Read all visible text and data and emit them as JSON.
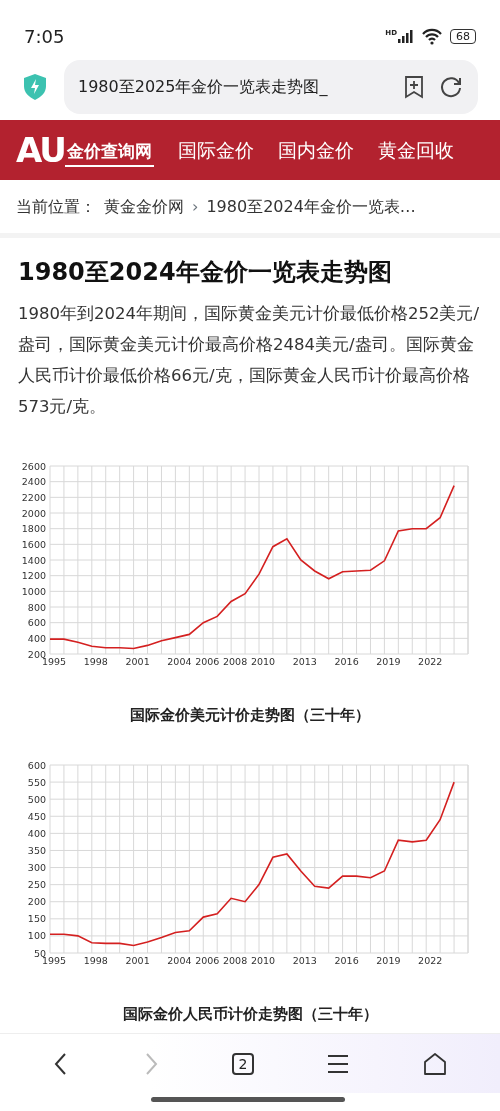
{
  "status_bar": {
    "time": "7:05",
    "network": "HD",
    "battery": "68"
  },
  "browser": {
    "address_text": "1980至2025年金价一览表走势图_"
  },
  "site_nav": {
    "logo_mark": "AU",
    "logo_text": "金价查询网",
    "items": [
      "国际金价",
      "国内金价",
      "黄金回收"
    ]
  },
  "breadcrumb": {
    "label": "当前位置：",
    "items": [
      {
        "text": "黄金金价网"
      },
      {
        "text": "1980至2024年金价一览表…",
        "separator": "›"
      }
    ]
  },
  "article": {
    "title": "1980至2024年金价一览表走势图",
    "paragraph": "1980年到2024年期间，国际黄金美元计价最低价格252美元/盎司，国际黄金美元计价最高价格2484美元/盎司。国际黄金人民币计价最低价格66元/克，国际黄金人民币计价最高价格573元/克。",
    "figures": [
      {
        "caption": "国际金价美元计价走势图（三十年）",
        "chart_data": {
          "type": "line",
          "x": [
            1995,
            1996,
            1997,
            1998,
            1999,
            2000,
            2001,
            2002,
            2003,
            2004,
            2005,
            2006,
            2007,
            2008,
            2009,
            2010,
            2011,
            2012,
            2013,
            2014,
            2015,
            2016,
            2017,
            2018,
            2019,
            2020,
            2021,
            2022,
            2023,
            2024
          ],
          "series": [
            {
              "color": "#d42020",
              "values": [
                390,
                390,
                350,
                300,
                280,
                280,
                270,
                310,
                370,
                410,
                450,
                600,
                680,
                870,
                970,
                1220,
                1570,
                1670,
                1400,
                1260,
                1160,
                1250,
                1260,
                1270,
                1390,
                1770,
                1800,
                1800,
                1940,
                2350
              ]
            }
          ],
          "xlim": [
            1995,
            2025
          ],
          "grid": true,
          "ylim": [
            200,
            2600
          ],
          "yticks": [
            200,
            400,
            600,
            800,
            1000,
            1200,
            1400,
            1600,
            1800,
            2000,
            2200,
            2400,
            2600
          ],
          "xticks": [
            1995,
            1998,
            2001,
            2004,
            2006,
            2008,
            2010,
            2013,
            2016,
            2019,
            2022
          ]
        }
      },
      {
        "caption": "国际金价人民币计价走势图（三十年）",
        "chart_data": {
          "type": "line",
          "x": [
            1995,
            1996,
            1997,
            1998,
            1999,
            2000,
            2001,
            2002,
            2003,
            2004,
            2005,
            2006,
            2007,
            2008,
            2009,
            2010,
            2011,
            2012,
            2013,
            2014,
            2015,
            2016,
            2017,
            2018,
            2019,
            2020,
            2021,
            2022,
            2023,
            2024
          ],
          "series": [
            {
              "color": "#d42020",
              "values": [
                105,
                105,
                100,
                80,
                78,
                78,
                72,
                82,
                95,
                110,
                115,
                155,
                165,
                210,
                200,
                250,
                330,
                340,
                290,
                245,
                240,
                275,
                275,
                270,
                290,
                380,
                375,
                380,
                440,
                550
              ]
            }
          ],
          "xlim": [
            1995,
            2025
          ],
          "grid": true,
          "ylim": [
            50,
            600
          ],
          "yticks": [
            50,
            100,
            150,
            200,
            250,
            300,
            350,
            400,
            450,
            500,
            550,
            600
          ],
          "xticks": [
            1995,
            1998,
            2001,
            2004,
            2006,
            2008,
            2010,
            2013,
            2016,
            2019,
            2022
          ]
        }
      }
    ]
  },
  "bottom_bar": {
    "back": {
      "disabled": false
    },
    "forward": {
      "disabled": true
    },
    "tab_count": "2"
  }
}
